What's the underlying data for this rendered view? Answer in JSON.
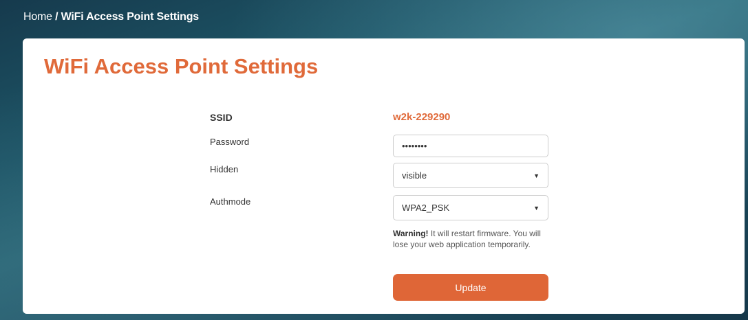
{
  "breadcrumb": {
    "home": "Home",
    "separator": " / ",
    "current": "WiFi Access Point Settings"
  },
  "page": {
    "title": "WiFi Access Point Settings"
  },
  "form": {
    "ssid_label": "SSID",
    "ssid_value": "w2k-229290",
    "password_label": "Password",
    "password_value": "password",
    "hidden_label": "Hidden",
    "hidden_value": "visible",
    "authmode_label": "Authmode",
    "authmode_value": "WPA2_PSK",
    "warning_bold": "Warning!",
    "warning_text": " It will restart firmware. You will lose your web application temporarily.",
    "update_label": "Update"
  },
  "colors": {
    "accent": "#e06a3a",
    "button": "#df6637"
  },
  "icons": {
    "select_arrow": "chevron-down-icon"
  }
}
